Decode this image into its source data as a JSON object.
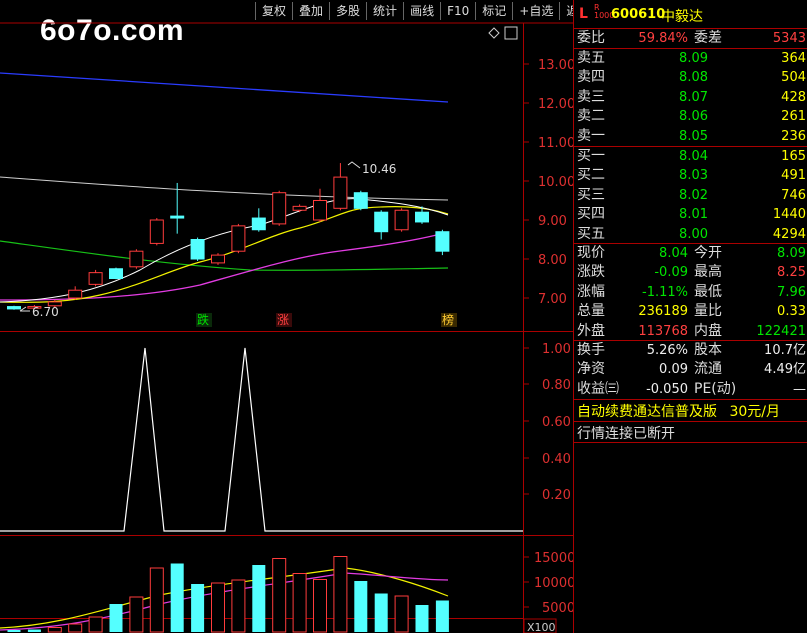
{
  "toolbar": [
    "复权",
    "叠加",
    "多股",
    "统计",
    "画线",
    "F10",
    "标记",
    "+自选",
    "返回"
  ],
  "logo": "6o7o.com",
  "main_chart": {
    "price_axis": [
      "13.00",
      "12.00",
      "11.00",
      "10.00",
      "9.00",
      "8.00",
      "7.00"
    ],
    "high_label": "10.46",
    "low_label": "6.70",
    "tags": [
      "跌",
      "涨",
      "榜"
    ],
    "candles": [
      {
        "o": 6.78,
        "c": 6.72,
        "h": 6.8,
        "l": 6.7
      },
      {
        "o": 6.74,
        "c": 6.78,
        "h": 6.82,
        "l": 6.72
      },
      {
        "o": 6.8,
        "c": 6.9,
        "h": 6.95,
        "l": 6.76
      },
      {
        "o": 7.0,
        "c": 7.2,
        "h": 7.3,
        "l": 6.95
      },
      {
        "o": 7.35,
        "c": 7.65,
        "h": 7.72,
        "l": 7.3
      },
      {
        "o": 7.75,
        "c": 7.5,
        "h": 7.78,
        "l": 7.48
      },
      {
        "o": 7.8,
        "c": 8.2,
        "h": 8.25,
        "l": 7.75
      },
      {
        "o": 8.4,
        "c": 9.0,
        "h": 9.05,
        "l": 8.35
      },
      {
        "o": 9.1,
        "c": 9.05,
        "h": 9.95,
        "l": 8.65
      },
      {
        "o": 8.5,
        "c": 8.0,
        "h": 8.55,
        "l": 7.95
      },
      {
        "o": 7.9,
        "c": 8.1,
        "h": 8.15,
        "l": 7.85
      },
      {
        "o": 8.2,
        "c": 8.85,
        "h": 8.9,
        "l": 8.15
      },
      {
        "o": 9.05,
        "c": 8.75,
        "h": 9.3,
        "l": 8.7
      },
      {
        "o": 8.9,
        "c": 9.7,
        "h": 9.75,
        "l": 8.85
      },
      {
        "o": 9.25,
        "c": 9.35,
        "h": 9.4,
        "l": 9.2
      },
      {
        "o": 9.0,
        "c": 9.5,
        "h": 9.8,
        "l": 8.95
      },
      {
        "o": 9.3,
        "c": 10.1,
        "h": 10.46,
        "l": 9.25
      },
      {
        "o": 9.7,
        "c": 9.3,
        "h": 9.75,
        "l": 9.25
      },
      {
        "o": 9.2,
        "c": 8.7,
        "h": 9.25,
        "l": 8.5
      },
      {
        "o": 8.75,
        "c": 9.25,
        "h": 9.3,
        "l": 8.7
      },
      {
        "o": 9.2,
        "c": 8.95,
        "h": 9.35,
        "l": 8.9
      },
      {
        "o": 8.7,
        "c": 8.2,
        "h": 8.75,
        "l": 8.1
      }
    ]
  },
  "indicator_chart": {
    "axis": [
      "1.00",
      "0.80",
      "0.60",
      "0.40",
      "0.20"
    ],
    "values": [
      0,
      0,
      0,
      0,
      0,
      0,
      0,
      1,
      0,
      0,
      0,
      0,
      1,
      0,
      0,
      0,
      0,
      0,
      0,
      0,
      0,
      0
    ]
  },
  "volume_chart": {
    "axis": [
      "15000",
      "10000",
      "5000"
    ],
    "unit": "X100",
    "values": [
      400,
      500,
      900,
      1600,
      3000,
      5600,
      7000,
      12800,
      13700,
      9600,
      9800,
      10400,
      13400,
      14700,
      11700,
      10500,
      15100,
      10200,
      7700,
      7200,
      5400,
      6300
    ],
    "up": [
      false,
      false,
      true,
      true,
      true,
      false,
      true,
      true,
      false,
      false,
      true,
      true,
      false,
      true,
      true,
      true,
      true,
      false,
      false,
      true,
      false,
      false
    ]
  },
  "quote": {
    "code": "600610",
    "name": "中毅达",
    "tag_L": "L",
    "tag_R": "R",
    "tag_num": "1000",
    "weibi_label": "委比",
    "weibi": "59.84%",
    "weicha_label": "委差",
    "weicha": "5343",
    "sell": [
      {
        "label": "卖五",
        "price": "8.09",
        "vol": "364"
      },
      {
        "label": "卖四",
        "price": "8.08",
        "vol": "504"
      },
      {
        "label": "卖三",
        "price": "8.07",
        "vol": "428"
      },
      {
        "label": "卖二",
        "price": "8.06",
        "vol": "261"
      },
      {
        "label": "卖一",
        "price": "8.05",
        "vol": "236"
      }
    ],
    "buy": [
      {
        "label": "买一",
        "price": "8.04",
        "vol": "165"
      },
      {
        "label": "买二",
        "price": "8.03",
        "vol": "491"
      },
      {
        "label": "买三",
        "price": "8.02",
        "vol": "746"
      },
      {
        "label": "买四",
        "price": "8.01",
        "vol": "1440"
      },
      {
        "label": "买五",
        "price": "8.00",
        "vol": "4294"
      }
    ],
    "stats": [
      {
        "l1": "现价",
        "v1": "8.04",
        "c1": "green",
        "l2": "今开",
        "v2": "8.09",
        "c2": "green"
      },
      {
        "l1": "涨跌",
        "v1": "-0.09",
        "c1": "green",
        "l2": "最高",
        "v2": "8.25",
        "c2": "red"
      },
      {
        "l1": "涨幅",
        "v1": "-1.11%",
        "c1": "green",
        "l2": "最低",
        "v2": "7.96",
        "c2": "green"
      },
      {
        "l1": "总量",
        "v1": "236189",
        "c1": "yellow",
        "l2": "量比",
        "v2": "0.33",
        "c2": "yellow"
      },
      {
        "l1": "外盘",
        "v1": "113768",
        "c1": "red",
        "l2": "内盘",
        "v2": "122421",
        "c2": "green"
      }
    ],
    "fundamentals": [
      {
        "l1": "换手",
        "v1": "5.26%",
        "l2": "股本",
        "v2": "10.7亿"
      },
      {
        "l1": "净资",
        "v1": "0.09",
        "l2": "流通",
        "v2": "4.49亿"
      },
      {
        "l1": "收益㈢",
        "v1": "-0.050",
        "l2": "PE(动)",
        "v2": "—"
      }
    ],
    "notice": "自动续费通达信普及版",
    "notice_price": "30元/月",
    "status": "行情连接已断开"
  }
}
